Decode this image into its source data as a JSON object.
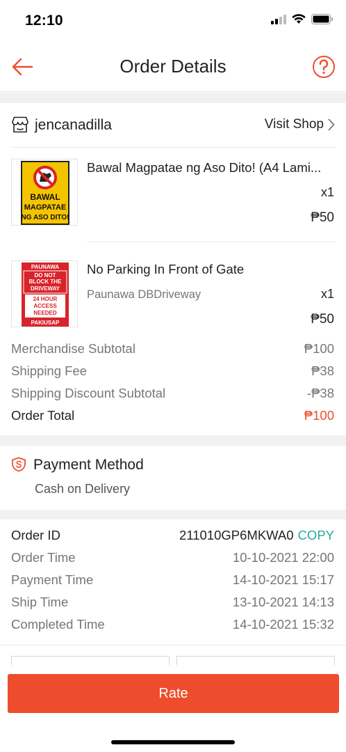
{
  "status": {
    "time": "12:10"
  },
  "nav": {
    "title": "Order Details"
  },
  "shop": {
    "name": "jencanadilla",
    "visit_label": "Visit Shop"
  },
  "products": [
    {
      "name": "Bawal Magpatae ng Aso Dito! (A4 Lami...",
      "variant": "",
      "qty": "x1",
      "price": "₱50",
      "image_text": [
        "BAWAL",
        "MAGPATAE",
        "NG ASO DITO!"
      ]
    },
    {
      "name": "No Parking In Front of Gate",
      "variant": "Paunawa DBDriveway",
      "qty": "x1",
      "price": "₱50",
      "image_text": [
        "PAUNAWA",
        "DO NOT",
        "BLOCK THE",
        "DRIVEWAY",
        "24 HOUR",
        "ACCESS",
        "NEEDED",
        "PAKIUSAP"
      ]
    }
  ],
  "summary": {
    "merch_label": "Merchandise Subtotal",
    "merch_value": "₱100",
    "ship_label": "Shipping Fee",
    "ship_value": "₱38",
    "discount_label": "Shipping Discount Subtotal",
    "discount_value": "-₱38",
    "total_label": "Order Total",
    "total_value": "₱100"
  },
  "payment": {
    "title": "Payment Method",
    "method": "Cash on Delivery"
  },
  "order": {
    "id_label": "Order ID",
    "id_value": "211010GP6MKWA0",
    "copy_label": "COPY",
    "order_time_label": "Order Time",
    "order_time_value": "10-10-2021 22:00",
    "payment_time_label": "Payment Time",
    "payment_time_value": "14-10-2021 15:17",
    "ship_time_label": "Ship Time",
    "ship_time_value": "13-10-2021 14:13",
    "completed_time_label": "Completed Time",
    "completed_time_value": "14-10-2021 15:32"
  },
  "actions": {
    "rate_label": "Rate"
  },
  "colors": {
    "accent": "#ee4d2d",
    "copy": "#26aa99",
    "sign_yellow": "#f5c400",
    "sign_red": "#d8232a"
  }
}
